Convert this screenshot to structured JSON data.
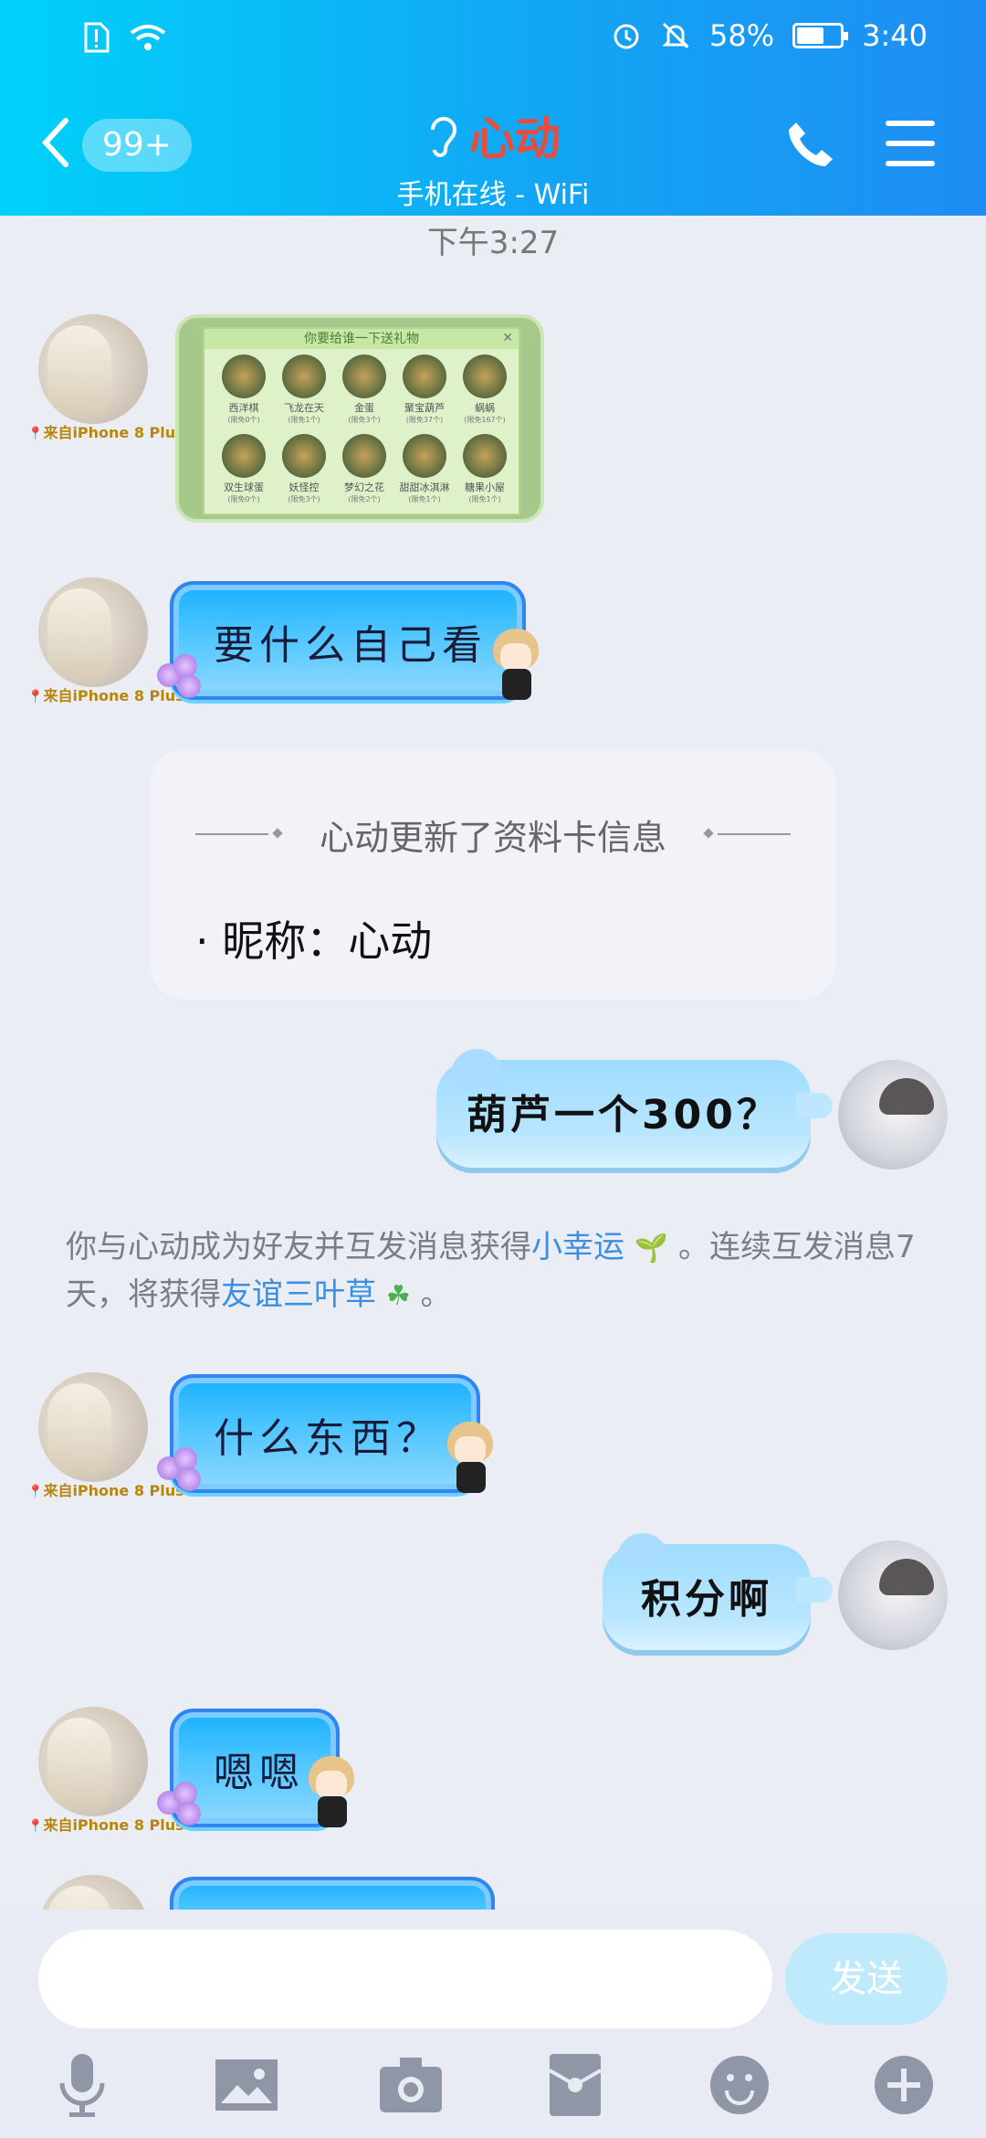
{
  "status": {
    "battery": "58%",
    "time": "3:40"
  },
  "header": {
    "unread_badge": "99+",
    "contact_name": "心动",
    "contact_status": "手机在线 - WiFi"
  },
  "chat": {
    "time_divider": "下午3:27",
    "device_label": "来自iPhone 8 Plus",
    "gift_card": {
      "header": "你要给谁一下送礼物",
      "items": [
        {
          "name": "西洋棋",
          "sub": "(限免0个)"
        },
        {
          "name": "飞龙在天",
          "sub": "(限免1个)"
        },
        {
          "name": "金蛋",
          "sub": "(限免3个)"
        },
        {
          "name": "聚宝葫芦",
          "sub": "(限免37个)"
        },
        {
          "name": "蜗蜗",
          "sub": "(限免167个)"
        },
        {
          "name": "双生球蛋",
          "sub": "(限免0个)"
        },
        {
          "name": "妖怪控",
          "sub": "(限免3个)"
        },
        {
          "name": "梦幻之花",
          "sub": "(限免2个)"
        },
        {
          "name": "甜甜冰淇淋",
          "sub": "(限免1个)"
        },
        {
          "name": "糖果小屋",
          "sub": "(限免1个)"
        }
      ]
    },
    "messages": [
      {
        "text": "要什么自己看"
      },
      {
        "text": "葫芦一个300？"
      },
      {
        "text": "什么东西？"
      },
      {
        "text": "积分啊"
      },
      {
        "text": "嗯嗯"
      }
    ],
    "profile_update": {
      "heading": "心动更新了资料卡信息",
      "nickname_line": "· 昵称：心动"
    },
    "system": {
      "part1": "你与心动成为好友并互发消息获得",
      "link1": "小幸运",
      "part2": "。连续互发消息7天，将获得",
      "link2": "友谊三叶草",
      "part3": "。"
    }
  },
  "composer": {
    "send_label": "发送"
  },
  "colors": {
    "header_start": "#00d1f9",
    "header_end": "#1e8df3",
    "contact_name": "#e84c3d",
    "link": "#3b8fe0"
  }
}
